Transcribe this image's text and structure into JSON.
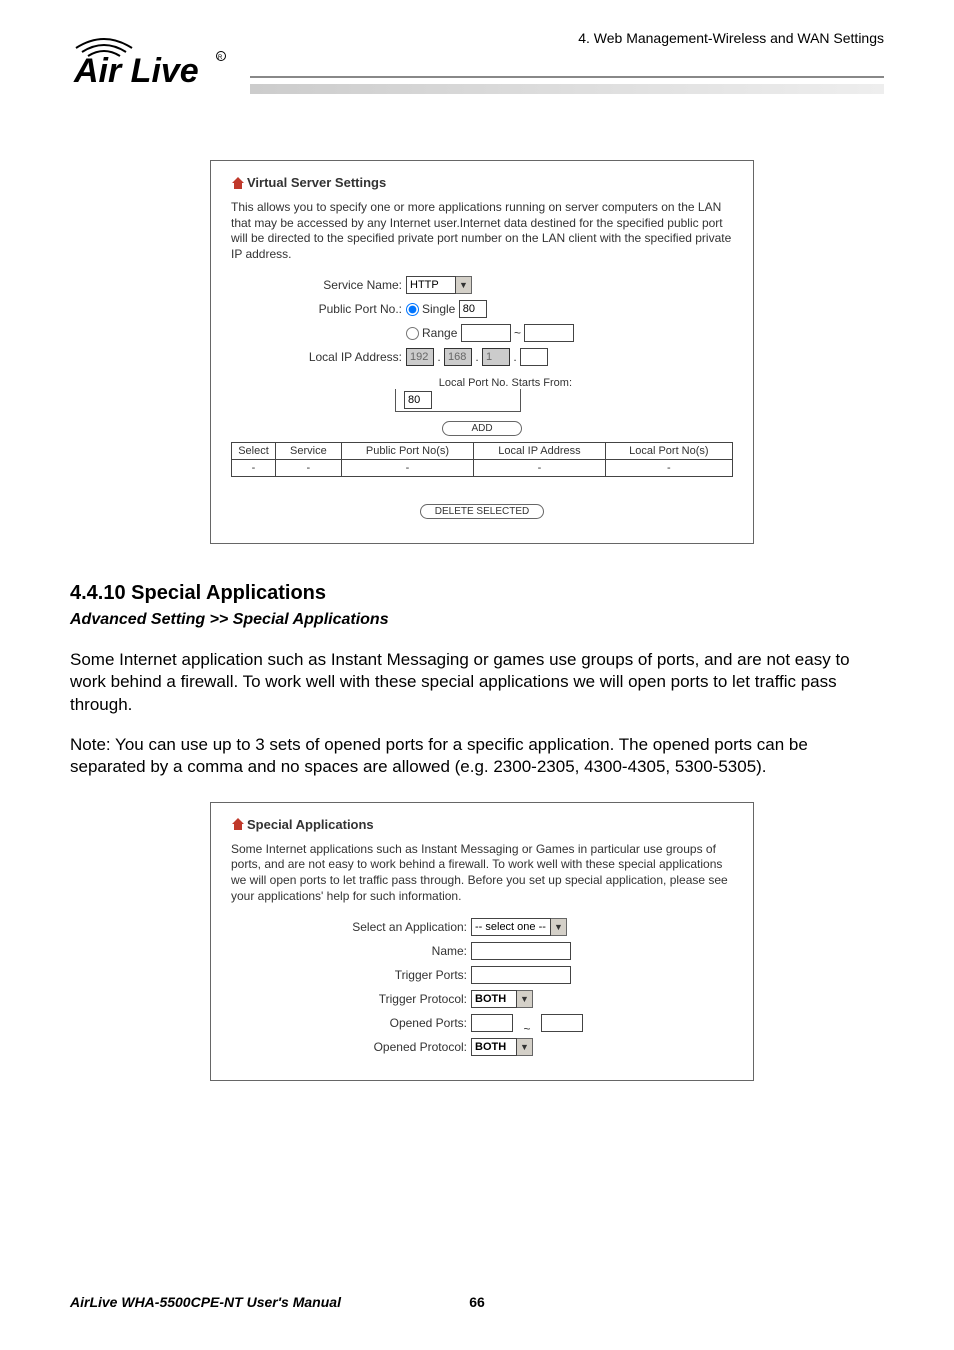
{
  "header": {
    "chapter": "4. Web Management-Wireless and WAN Settings",
    "logo_alt": "AirLive"
  },
  "panel1": {
    "title": "Virtual Server Settings",
    "description": "This allows you to specify one or more applications running on server computers on the LAN that may be accessed by any Internet user.Internet data destined for the specified public port will be directed to the specified private port number on the LAN client with the specified private IP address.",
    "service_name_label": "Service Name:",
    "service_name_value": "HTTP",
    "public_port_label": "Public Port No.:",
    "single_label": "Single",
    "single_value": "80",
    "range_label": "Range",
    "range_from": "",
    "range_to": "",
    "local_ip_label": "Local IP Address:",
    "ip_octets": [
      "192",
      "168",
      "1",
      ""
    ],
    "local_port_legend": "Local Port No. Starts From:",
    "local_port_value": "80",
    "add_button": "ADD",
    "table_headers": [
      "Select",
      "Service",
      "Public Port No(s)",
      "Local IP Address",
      "Local Port No(s)"
    ],
    "table_row": [
      "-",
      "-",
      "-",
      "-",
      "-"
    ],
    "delete_button": "DELETE SELECTED"
  },
  "section": {
    "heading": "4.4.10 Special Applications",
    "breadcrumb": "Advanced Setting >> Special Applications",
    "para1": "Some Internet application such as Instant Messaging or games use groups of ports, and are not easy to work behind a firewall. To work well with these special applications we will open ports to let traffic pass through.",
    "para2": "Note: You can use up to 3 sets of opened ports for a specific application. The opened ports can be separated by a comma and no spaces are allowed (e.g. 2300-2305, 4300-4305, 5300-5305)."
  },
  "panel2": {
    "title": "Special Applications",
    "description": "Some Internet applications such as Instant Messaging or Games in particular use groups of ports, and are not easy to work behind a firewall. To work well with these special applications we will open ports to let traffic pass through. Before you set up special application, please see your applications' help for such information.",
    "select_app_label": "Select an Application:",
    "select_app_value": "-- select one --",
    "name_label": "Name:",
    "name_value": "",
    "trigger_ports_label": "Trigger Ports:",
    "trigger_ports_value": "",
    "trigger_protocol_label": "Trigger Protocol:",
    "trigger_protocol_value": "BOTH",
    "opened_ports_label": "Opened Ports:",
    "opened_ports_from": "",
    "opened_ports_to": "",
    "opened_protocol_label": "Opened Protocol:",
    "opened_protocol_value": "BOTH"
  },
  "footer": {
    "manual": "AirLive WHA-5500CPE-NT User's Manual",
    "page": "66"
  }
}
